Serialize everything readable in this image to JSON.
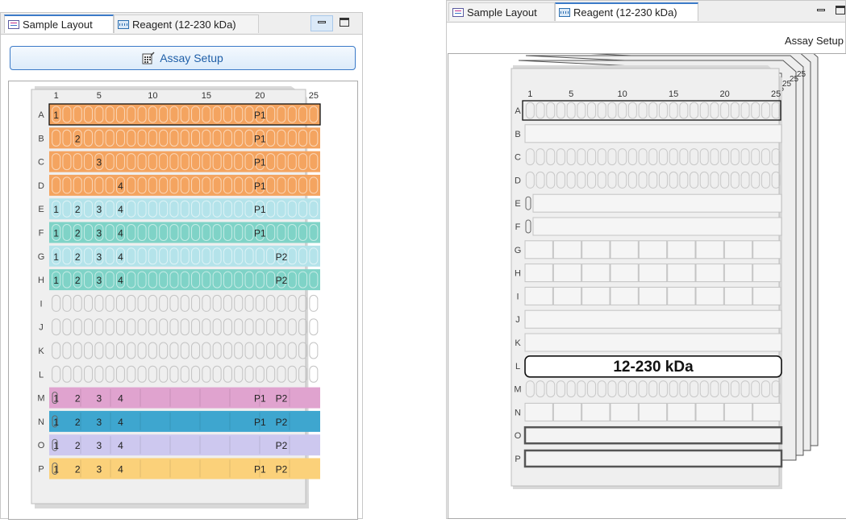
{
  "left_panel": {
    "tabs": [
      {
        "label": "Sample Layout",
        "icon": "layout-icon",
        "active": true
      },
      {
        "label": "Reagent (12-230 kDa)",
        "icon": "reagent-icon",
        "active": false
      }
    ],
    "assay_button_label": "Assay Setup",
    "plate": {
      "col_labels": [
        "1",
        "5",
        "10",
        "15",
        "20",
        "25"
      ],
      "rows": [
        {
          "row": "A",
          "color": "#f4a460",
          "labels": [
            "1",
            "",
            "",
            "",
            "P1",
            ""
          ],
          "selected": true
        },
        {
          "row": "B",
          "color": "#f4a460",
          "labels": [
            "",
            "2",
            "",
            "",
            "P1",
            ""
          ]
        },
        {
          "row": "C",
          "color": "#f4a460",
          "labels": [
            "",
            "",
            "3",
            "",
            "P1",
            ""
          ]
        },
        {
          "row": "D",
          "color": "#f4a460",
          "labels": [
            "",
            "",
            "",
            "4",
            "P1",
            ""
          ]
        },
        {
          "row": "E",
          "color": "#b4e3ea",
          "labels": [
            "1",
            "2",
            "3",
            "4",
            "P1",
            ""
          ]
        },
        {
          "row": "F",
          "color": "#7fd3c7",
          "labels": [
            "1",
            "2",
            "3",
            "4",
            "P1",
            ""
          ]
        },
        {
          "row": "G",
          "color": "#b4e3ea",
          "labels": [
            "1",
            "2",
            "3",
            "4",
            "",
            "P2"
          ]
        },
        {
          "row": "H",
          "color": "#7fd3c7",
          "labels": [
            "1",
            "2",
            "3",
            "4",
            "",
            "P2"
          ]
        },
        {
          "row": "I",
          "color": "",
          "labels": []
        },
        {
          "row": "J",
          "color": "",
          "labels": []
        },
        {
          "row": "K",
          "color": "",
          "labels": []
        },
        {
          "row": "L",
          "color": "",
          "labels": []
        },
        {
          "row": "M",
          "color": "#e0a3cf",
          "labels": [
            "1",
            "2",
            "3",
            "4",
            "P1",
            "P2"
          ]
        },
        {
          "row": "N",
          "color": "#3ea6cf",
          "labels": [
            "1",
            "2",
            "3",
            "4",
            "P1",
            "P2"
          ]
        },
        {
          "row": "O",
          "color": "#cdc8ef",
          "labels": [
            "1",
            "2",
            "3",
            "4",
            "",
            "P2"
          ]
        },
        {
          "row": "P",
          "color": "#fbd17a",
          "labels": [
            "1",
            "2",
            "3",
            "4",
            "P1",
            "P2"
          ]
        }
      ]
    }
  },
  "right_panel": {
    "tabs": [
      {
        "label": "Sample Layout",
        "icon": "layout-icon",
        "active": false
      },
      {
        "label": "Reagent (12-230 kDa)",
        "icon": "reagent-icon",
        "active": true
      }
    ],
    "assay_link_label": "Assay Setup",
    "plate": {
      "col_labels": [
        "1",
        "5",
        "10",
        "15",
        "20",
        "25"
      ],
      "stack_labels": [
        "25",
        "25",
        "25",
        "25"
      ],
      "row_letters": [
        "A",
        "B",
        "C",
        "D",
        "E",
        "F",
        "G",
        "H",
        "I",
        "J",
        "K",
        "L",
        "M",
        "N",
        "O",
        "P"
      ],
      "reagent_label": "12-230 kDa"
    }
  }
}
